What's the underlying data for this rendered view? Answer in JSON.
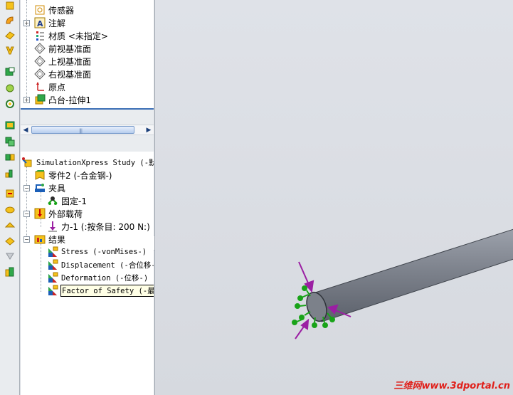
{
  "feature_tree": {
    "items": [
      {
        "label": "传感器",
        "icon": "sensor-icon"
      },
      {
        "label": "注解",
        "icon": "annotation-icon"
      },
      {
        "label": "材质 <未指定>",
        "icon": "material-icon"
      },
      {
        "label": "前视基准面",
        "icon": "plane-icon"
      },
      {
        "label": "上视基准面",
        "icon": "plane-icon"
      },
      {
        "label": "右视基准面",
        "icon": "plane-icon"
      },
      {
        "label": "原点",
        "icon": "origin-icon"
      },
      {
        "label": "凸台-拉伸1",
        "icon": "extrude-icon"
      }
    ]
  },
  "simulation_tree": {
    "study": "SimulationXpress Study (-默认",
    "part": "零件2 (-合金钢-)",
    "fixtures": "夹具",
    "fixture_item": "固定-1",
    "loads": "外部载荷",
    "load_item": "力-1 (:按条目: 200 N:)",
    "results": "结果",
    "result_items": [
      "Stress (-vonMises-)",
      "Displacement (-合位移-)",
      "Deformation (-位移-)",
      "Factor of Safety (-最大"
    ]
  },
  "watermark": {
    "cn": "三维网",
    "url": "www.3dportal.cn"
  },
  "colors": {
    "selection_blue": "#3b6fb5",
    "load_arrow": "#9b1fa3",
    "fixture_green": "#19a319",
    "part_gray": "#7d828c"
  }
}
